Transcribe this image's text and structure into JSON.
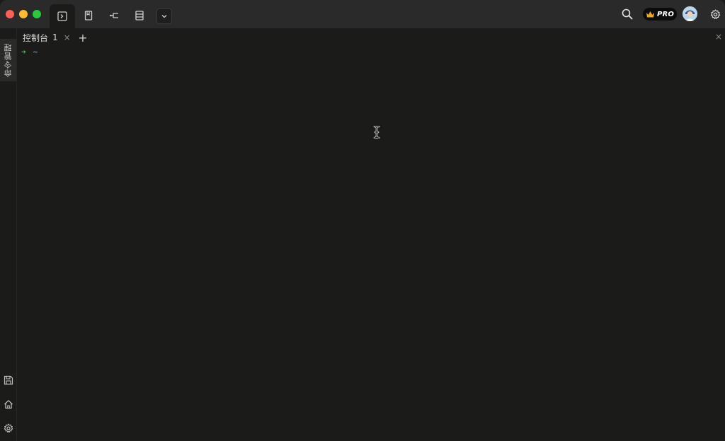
{
  "titlebar": {
    "toolbar": [
      {
        "id": "terminal",
        "icon": "terminal-icon",
        "active": true
      },
      {
        "id": "notes",
        "icon": "bookmark-icon"
      },
      {
        "id": "transfer",
        "icon": "split-flow-icon"
      },
      {
        "id": "list",
        "icon": "list-icon"
      }
    ],
    "dropdown_icon": "chevron-down-icon",
    "right": {
      "search_icon": "search-icon",
      "pro_label": "PRO",
      "crown_icon": "crown-icon",
      "avatar": "avatar",
      "settings_icon": "gear-icon"
    }
  },
  "sidebar": {
    "tab_label": "命令管理",
    "bottom_icons": [
      "save-icon",
      "home-icon",
      "gear-icon"
    ]
  },
  "tabs": [
    {
      "label": "控制台",
      "index": "1",
      "close": "×"
    }
  ],
  "tab_add": "+",
  "panel_close": "×",
  "terminal": {
    "prompt_arrow": "➜",
    "prompt_dir": "~"
  },
  "colors": {
    "background": "#1b1b19",
    "titlebar": "#2a2a2a",
    "prompt_arrow": "#4fc04f",
    "prompt_dir": "#4aa3ff",
    "traffic_red": "#fe5f57",
    "traffic_yellow": "#febc2e",
    "traffic_green": "#28c840"
  }
}
